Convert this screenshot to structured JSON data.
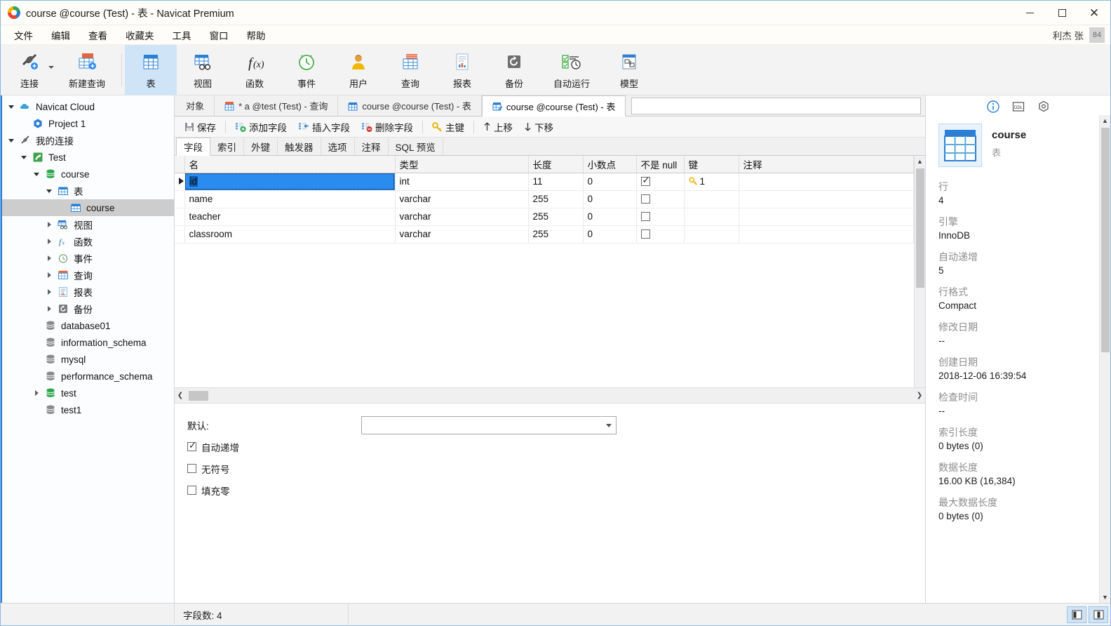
{
  "window": {
    "title": "course @course (Test) - 表 - Navicat Premium",
    "logo_icon": "navicat-logo-icon",
    "minimize_icon": "minimize-icon",
    "maximize_icon": "maximize-icon",
    "close_icon": "close-icon"
  },
  "menubar": {
    "items": [
      {
        "label": "文件"
      },
      {
        "label": "编辑"
      },
      {
        "label": "查看"
      },
      {
        "label": "收藏夹"
      },
      {
        "label": "工具"
      },
      {
        "label": "窗口"
      },
      {
        "label": "帮助"
      }
    ],
    "user_name": "利杰 张",
    "user_badge": "84"
  },
  "ribbon": {
    "buttons": [
      {
        "label": "连接",
        "icon": "connection-icon",
        "active": false,
        "has_caret": true
      },
      {
        "label": "新建查询",
        "icon": "new-query-icon",
        "active": false,
        "has_caret": false
      },
      {
        "label": "表",
        "icon": "table-icon",
        "active": true,
        "has_caret": false
      },
      {
        "label": "视图",
        "icon": "view-icon",
        "active": false,
        "has_caret": false
      },
      {
        "label": "函数",
        "icon": "function-icon",
        "active": false,
        "has_caret": false
      },
      {
        "label": "事件",
        "icon": "event-clock-icon",
        "active": false,
        "has_caret": false
      },
      {
        "label": "用户",
        "icon": "user-icon",
        "active": false,
        "has_caret": false
      },
      {
        "label": "查询",
        "icon": "query-icon",
        "active": false,
        "has_caret": false
      },
      {
        "label": "报表",
        "icon": "report-icon",
        "active": false,
        "has_caret": false
      },
      {
        "label": "备份",
        "icon": "backup-icon",
        "active": false,
        "has_caret": false
      },
      {
        "label": "自动运行",
        "icon": "automation-icon",
        "active": false,
        "has_caret": false
      },
      {
        "label": "模型",
        "icon": "model-icon",
        "active": false,
        "has_caret": false
      }
    ]
  },
  "sidebar": {
    "items": [
      {
        "label": "Navicat Cloud",
        "indent": 0,
        "twisty": "open",
        "icon": "cloud-icon",
        "selected": false
      },
      {
        "label": "Project 1",
        "indent": 1,
        "twisty": "none",
        "icon": "project-icon",
        "selected": false
      },
      {
        "label": "我的连接",
        "indent": 0,
        "twisty": "open",
        "icon": "connections-icon",
        "selected": false
      },
      {
        "label": "Test",
        "indent": 1,
        "twisty": "open",
        "icon": "mysql-conn-icon",
        "selected": false
      },
      {
        "label": "course",
        "indent": 2,
        "twisty": "open",
        "icon": "database-green-icon",
        "selected": false
      },
      {
        "label": "表",
        "indent": 3,
        "twisty": "open",
        "icon": "table-folder-icon",
        "selected": false
      },
      {
        "label": "course",
        "indent": 4,
        "twisty": "none",
        "icon": "table-icon",
        "selected": true
      },
      {
        "label": "视图",
        "indent": 3,
        "twisty": "closed",
        "icon": "view-icon",
        "selected": false
      },
      {
        "label": "函数",
        "indent": 3,
        "twisty": "closed",
        "icon": "function-icon",
        "selected": false
      },
      {
        "label": "事件",
        "indent": 3,
        "twisty": "closed",
        "icon": "event-clock-icon",
        "selected": false
      },
      {
        "label": "查询",
        "indent": 3,
        "twisty": "closed",
        "icon": "query-icon",
        "selected": false
      },
      {
        "label": "报表",
        "indent": 3,
        "twisty": "closed",
        "icon": "report-icon",
        "selected": false
      },
      {
        "label": "备份",
        "indent": 3,
        "twisty": "closed",
        "icon": "backup-icon",
        "selected": false
      },
      {
        "label": "database01",
        "indent": 2,
        "twisty": "none",
        "icon": "database-gray-icon",
        "selected": false
      },
      {
        "label": "information_schema",
        "indent": 2,
        "twisty": "none",
        "icon": "database-gray-icon",
        "selected": false
      },
      {
        "label": "mysql",
        "indent": 2,
        "twisty": "none",
        "icon": "database-gray-icon",
        "selected": false
      },
      {
        "label": "performance_schema",
        "indent": 2,
        "twisty": "none",
        "icon": "database-gray-icon",
        "selected": false
      },
      {
        "label": "test",
        "indent": 2,
        "twisty": "closed",
        "icon": "database-green-icon",
        "selected": false
      },
      {
        "label": "test1",
        "indent": 2,
        "twisty": "none",
        "icon": "database-gray-icon",
        "selected": false
      }
    ]
  },
  "tabstrip": {
    "tabs": [
      {
        "label": "对象",
        "icon": "none",
        "active": false
      },
      {
        "label": "* a @test (Test) - 查询",
        "icon": "query-tab-icon",
        "active": false
      },
      {
        "label": "course @course (Test) - 表",
        "icon": "table-tab-icon",
        "active": false
      },
      {
        "label": "course @course (Test) - 表",
        "icon": "design-tab-icon",
        "active": true
      }
    ],
    "search_value": "",
    "search_placeholder": ""
  },
  "toolbar": {
    "buttons": [
      {
        "label": "保存",
        "icon": "save-icon"
      },
      {
        "label": "添加字段",
        "icon": "add-field-icon"
      },
      {
        "label": "插入字段",
        "icon": "insert-field-icon"
      },
      {
        "label": "删除字段",
        "icon": "delete-field-icon"
      },
      {
        "label": "主键",
        "icon": "primary-key-icon"
      },
      {
        "label": "上移",
        "icon": "move-up-icon"
      },
      {
        "label": "下移",
        "icon": "move-down-icon"
      }
    ]
  },
  "subtabs": {
    "items": [
      {
        "label": "字段",
        "active": true
      },
      {
        "label": "索引",
        "active": false
      },
      {
        "label": "外键",
        "active": false
      },
      {
        "label": "触发器",
        "active": false
      },
      {
        "label": "选项",
        "active": false
      },
      {
        "label": "注释",
        "active": false
      },
      {
        "label": "SQL 预览",
        "active": false
      }
    ]
  },
  "grid": {
    "columns": [
      "名",
      "类型",
      "长度",
      "小数点",
      "不是 null",
      "键",
      "注释"
    ],
    "rows": [
      {
        "marker": true,
        "name": "id",
        "type": "int",
        "length": "11",
        "decimals": "0",
        "not_null": true,
        "key": "1",
        "comment": "",
        "selected": true
      },
      {
        "marker": false,
        "name": "name",
        "type": "varchar",
        "length": "255",
        "decimals": "0",
        "not_null": false,
        "key": "",
        "comment": "",
        "selected": false
      },
      {
        "marker": false,
        "name": "teacher",
        "type": "varchar",
        "length": "255",
        "decimals": "0",
        "not_null": false,
        "key": "",
        "comment": "",
        "selected": false
      },
      {
        "marker": false,
        "name": "classroom",
        "type": "varchar",
        "length": "255",
        "decimals": "0",
        "not_null": false,
        "key": "",
        "comment": "",
        "selected": false
      }
    ]
  },
  "propeditor": {
    "default_label": "默认:",
    "default_value": "",
    "checkboxes": [
      {
        "label": "自动递增",
        "checked": true
      },
      {
        "label": "无符号",
        "checked": false
      },
      {
        "label": "填充零",
        "checked": false
      }
    ]
  },
  "infopanel": {
    "icons": [
      {
        "name": "info-icon",
        "active": true
      },
      {
        "name": "ddl-icon",
        "active": false
      },
      {
        "name": "gear-icon",
        "active": false
      }
    ],
    "object_icon": "table-large-icon",
    "object_name": "course",
    "object_type": "表",
    "properties": [
      {
        "key": "行",
        "value": "4"
      },
      {
        "key": "引擎",
        "value": "InnoDB"
      },
      {
        "key": "自动递增",
        "value": "5"
      },
      {
        "key": "行格式",
        "value": "Compact"
      },
      {
        "key": "修改日期",
        "value": "--"
      },
      {
        "key": "创建日期",
        "value": "2018-12-06 16:39:54"
      },
      {
        "key": "检查时间",
        "value": "--"
      },
      {
        "key": "索引长度",
        "value": "0 bytes (0)"
      },
      {
        "key": "数据长度",
        "value": "16.00 KB (16,384)"
      },
      {
        "key": "最大数据长度",
        "value": "0 bytes (0)"
      }
    ]
  },
  "statusbar": {
    "left": "",
    "field_count": "字段数: 4",
    "toggles": [
      {
        "name": "split-view-left-icon",
        "active": true
      },
      {
        "name": "split-view-right-icon",
        "active": true
      }
    ]
  },
  "colors": {
    "accent": "#2b7fd4",
    "selection": "#2b8cf0",
    "ribbon_active": "#cfe4f7",
    "tree_selected": "#cdcdcd",
    "key_yellow": "#e8b810",
    "green": "#2fa84f"
  }
}
